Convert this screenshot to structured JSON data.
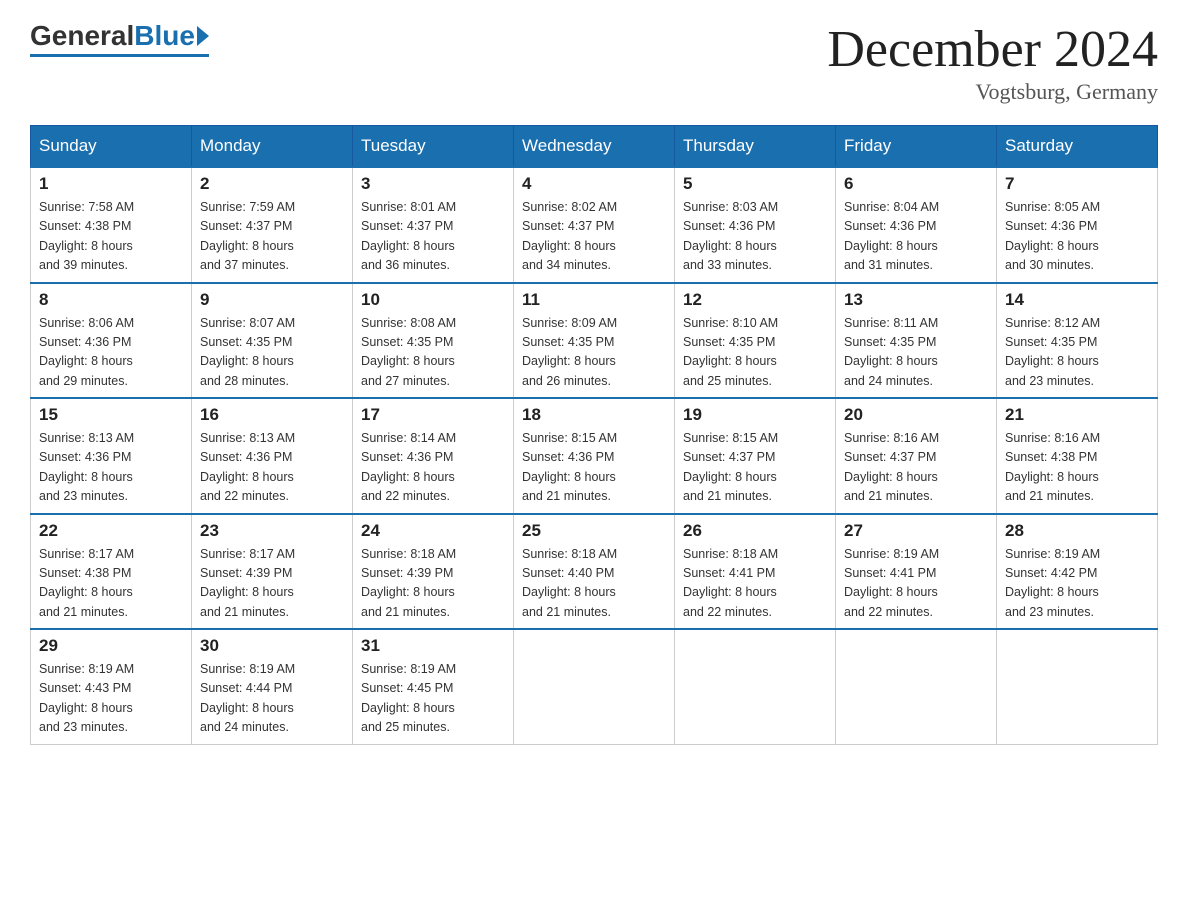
{
  "logo": {
    "general": "General",
    "blue": "Blue"
  },
  "header": {
    "title": "December 2024",
    "subtitle": "Vogtsburg, Germany"
  },
  "weekdays": [
    "Sunday",
    "Monday",
    "Tuesday",
    "Wednesday",
    "Thursday",
    "Friday",
    "Saturday"
  ],
  "weeks": [
    [
      {
        "day": "1",
        "sunrise": "7:58 AM",
        "sunset": "4:38 PM",
        "daylight": "8 hours and 39 minutes."
      },
      {
        "day": "2",
        "sunrise": "7:59 AM",
        "sunset": "4:37 PM",
        "daylight": "8 hours and 37 minutes."
      },
      {
        "day": "3",
        "sunrise": "8:01 AM",
        "sunset": "4:37 PM",
        "daylight": "8 hours and 36 minutes."
      },
      {
        "day": "4",
        "sunrise": "8:02 AM",
        "sunset": "4:37 PM",
        "daylight": "8 hours and 34 minutes."
      },
      {
        "day": "5",
        "sunrise": "8:03 AM",
        "sunset": "4:36 PM",
        "daylight": "8 hours and 33 minutes."
      },
      {
        "day": "6",
        "sunrise": "8:04 AM",
        "sunset": "4:36 PM",
        "daylight": "8 hours and 31 minutes."
      },
      {
        "day": "7",
        "sunrise": "8:05 AM",
        "sunset": "4:36 PM",
        "daylight": "8 hours and 30 minutes."
      }
    ],
    [
      {
        "day": "8",
        "sunrise": "8:06 AM",
        "sunset": "4:36 PM",
        "daylight": "8 hours and 29 minutes."
      },
      {
        "day": "9",
        "sunrise": "8:07 AM",
        "sunset": "4:35 PM",
        "daylight": "8 hours and 28 minutes."
      },
      {
        "day": "10",
        "sunrise": "8:08 AM",
        "sunset": "4:35 PM",
        "daylight": "8 hours and 27 minutes."
      },
      {
        "day": "11",
        "sunrise": "8:09 AM",
        "sunset": "4:35 PM",
        "daylight": "8 hours and 26 minutes."
      },
      {
        "day": "12",
        "sunrise": "8:10 AM",
        "sunset": "4:35 PM",
        "daylight": "8 hours and 25 minutes."
      },
      {
        "day": "13",
        "sunrise": "8:11 AM",
        "sunset": "4:35 PM",
        "daylight": "8 hours and 24 minutes."
      },
      {
        "day": "14",
        "sunrise": "8:12 AM",
        "sunset": "4:35 PM",
        "daylight": "8 hours and 23 minutes."
      }
    ],
    [
      {
        "day": "15",
        "sunrise": "8:13 AM",
        "sunset": "4:36 PM",
        "daylight": "8 hours and 23 minutes."
      },
      {
        "day": "16",
        "sunrise": "8:13 AM",
        "sunset": "4:36 PM",
        "daylight": "8 hours and 22 minutes."
      },
      {
        "day": "17",
        "sunrise": "8:14 AM",
        "sunset": "4:36 PM",
        "daylight": "8 hours and 22 minutes."
      },
      {
        "day": "18",
        "sunrise": "8:15 AM",
        "sunset": "4:36 PM",
        "daylight": "8 hours and 21 minutes."
      },
      {
        "day": "19",
        "sunrise": "8:15 AM",
        "sunset": "4:37 PM",
        "daylight": "8 hours and 21 minutes."
      },
      {
        "day": "20",
        "sunrise": "8:16 AM",
        "sunset": "4:37 PM",
        "daylight": "8 hours and 21 minutes."
      },
      {
        "day": "21",
        "sunrise": "8:16 AM",
        "sunset": "4:38 PM",
        "daylight": "8 hours and 21 minutes."
      }
    ],
    [
      {
        "day": "22",
        "sunrise": "8:17 AM",
        "sunset": "4:38 PM",
        "daylight": "8 hours and 21 minutes."
      },
      {
        "day": "23",
        "sunrise": "8:17 AM",
        "sunset": "4:39 PM",
        "daylight": "8 hours and 21 minutes."
      },
      {
        "day": "24",
        "sunrise": "8:18 AM",
        "sunset": "4:39 PM",
        "daylight": "8 hours and 21 minutes."
      },
      {
        "day": "25",
        "sunrise": "8:18 AM",
        "sunset": "4:40 PM",
        "daylight": "8 hours and 21 minutes."
      },
      {
        "day": "26",
        "sunrise": "8:18 AM",
        "sunset": "4:41 PM",
        "daylight": "8 hours and 22 minutes."
      },
      {
        "day": "27",
        "sunrise": "8:19 AM",
        "sunset": "4:41 PM",
        "daylight": "8 hours and 22 minutes."
      },
      {
        "day": "28",
        "sunrise": "8:19 AM",
        "sunset": "4:42 PM",
        "daylight": "8 hours and 23 minutes."
      }
    ],
    [
      {
        "day": "29",
        "sunrise": "8:19 AM",
        "sunset": "4:43 PM",
        "daylight": "8 hours and 23 minutes."
      },
      {
        "day": "30",
        "sunrise": "8:19 AM",
        "sunset": "4:44 PM",
        "daylight": "8 hours and 24 minutes."
      },
      {
        "day": "31",
        "sunrise": "8:19 AM",
        "sunset": "4:45 PM",
        "daylight": "8 hours and 25 minutes."
      },
      null,
      null,
      null,
      null
    ]
  ],
  "labels": {
    "sunrise": "Sunrise:",
    "sunset": "Sunset:",
    "daylight": "Daylight:"
  }
}
